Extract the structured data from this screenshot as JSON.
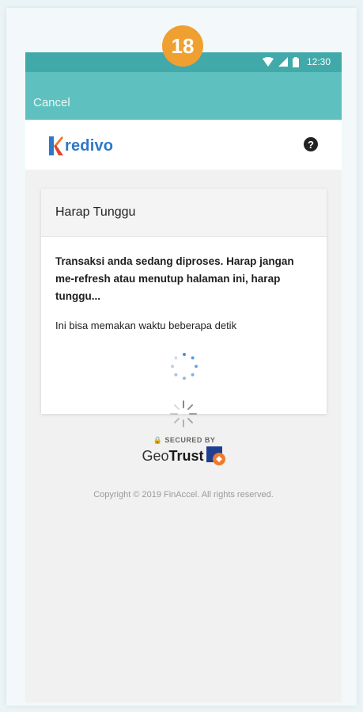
{
  "step_badge": "18",
  "status_bar": {
    "time": "12:30",
    "icons": [
      "wifi-icon",
      "signal-icon",
      "battery-icon"
    ]
  },
  "app_bar": {
    "cancel_label": "Cancel"
  },
  "brand": {
    "logo_k": "K",
    "logo_rest": "redivo",
    "help_icon": "question-circle-icon",
    "help_glyph": "?"
  },
  "card": {
    "title": "Harap Tunggu",
    "message": "Transaksi anda sedang diproses. Harap jangan me-refresh atau menutup halaman ini, harap tunggu...",
    "note": "Ini bisa memakan waktu beberapa detik"
  },
  "security": {
    "secured_label": "🔒 SECURED BY",
    "geo": "Geo",
    "trust": "Trust"
  },
  "footer": {
    "copyright": "Copyright © 2019 FinAccel. All rights reserved."
  },
  "colors": {
    "status_bar": "#41a9aa",
    "app_bar": "#5fc1bf",
    "badge": "#f0a030",
    "logo_blue": "#2f78c8",
    "logo_orange": "#f07a2a"
  }
}
